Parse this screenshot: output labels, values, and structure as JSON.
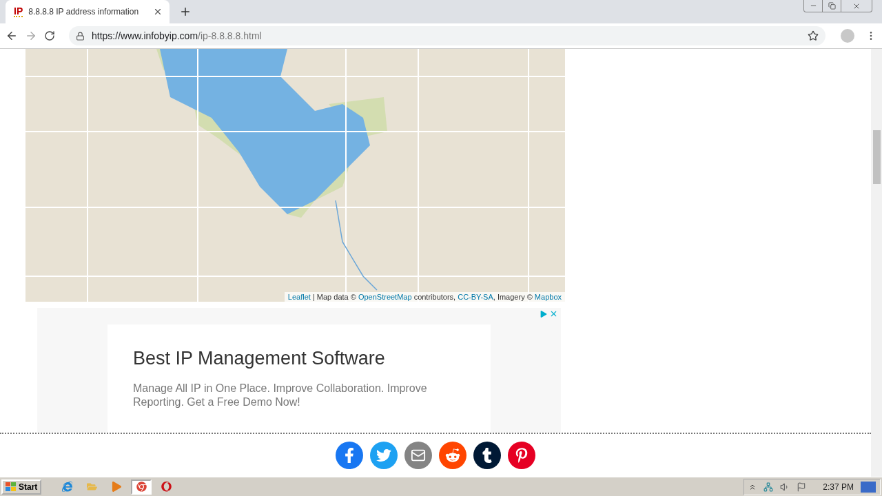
{
  "browser": {
    "tab": {
      "favicon": "IP",
      "title": "8.8.8.8 IP address information",
      "selected": true
    },
    "url": {
      "host": "https://www.infobyip.com",
      "path": "/ip-8.8.8.8.html"
    }
  },
  "map": {
    "attribution": [
      {
        "text": "Leaflet",
        "link": true
      },
      {
        "text": " | Map data © ",
        "link": false
      },
      {
        "text": "OpenStreetMap",
        "link": true
      },
      {
        "text": " contributors, ",
        "link": false
      },
      {
        "text": "CC-BY-SA",
        "link": true
      },
      {
        "text": ", Imagery © ",
        "link": false
      },
      {
        "text": "Mapbox",
        "link": true
      }
    ]
  },
  "ad": {
    "title": "Best IP Management Software",
    "body": "Manage All IP in One Place. Improve Collaboration. Improve Reporting. Get a Free Demo Now!"
  },
  "share": [
    {
      "kind": "facebook",
      "color": "#1877f2"
    },
    {
      "kind": "twitter",
      "color": "#1da1f2"
    },
    {
      "kind": "email",
      "color": "#848484"
    },
    {
      "kind": "reddit",
      "color": "#ff4500"
    },
    {
      "kind": "tumblr",
      "color": "#001935"
    },
    {
      "kind": "pinterest",
      "color": "#e60023"
    }
  ],
  "taskbar": {
    "start": "Start",
    "apps": [
      {
        "kind": "ie",
        "selected": false
      },
      {
        "kind": "folder",
        "selected": false
      },
      {
        "kind": "media",
        "selected": false
      },
      {
        "kind": "chrome",
        "selected": true
      },
      {
        "kind": "opera",
        "selected": false
      }
    ],
    "clock": "2:37 PM"
  }
}
